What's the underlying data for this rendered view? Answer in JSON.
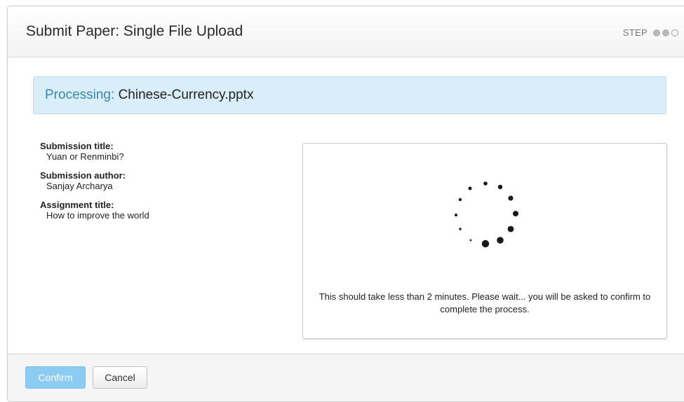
{
  "header": {
    "title": "Submit Paper: Single File Upload",
    "step_label": "STEP",
    "steps_total": 3,
    "steps_completed": 2
  },
  "processing": {
    "label": "Processing:",
    "filename": "Chinese-Currency.pptx"
  },
  "submission": {
    "title_label": "Submission title:",
    "title_value": "Yuan or Renminbi?",
    "author_label": "Submission author:",
    "author_value": "Sanjay Archarya",
    "assignment_label": "Assignment title:",
    "assignment_value": "How to improve the world"
  },
  "status": {
    "spinner_icon": "loading-spinner-icon",
    "message": "This should take less than 2 minutes. Please wait... you will be asked to confirm to complete the process."
  },
  "footer": {
    "confirm_label": "Confirm",
    "cancel_label": "Cancel"
  },
  "colors": {
    "accent": "#3a87ad",
    "banner_bg": "#d9eef8",
    "confirm_bg": "#8ccbf2"
  }
}
